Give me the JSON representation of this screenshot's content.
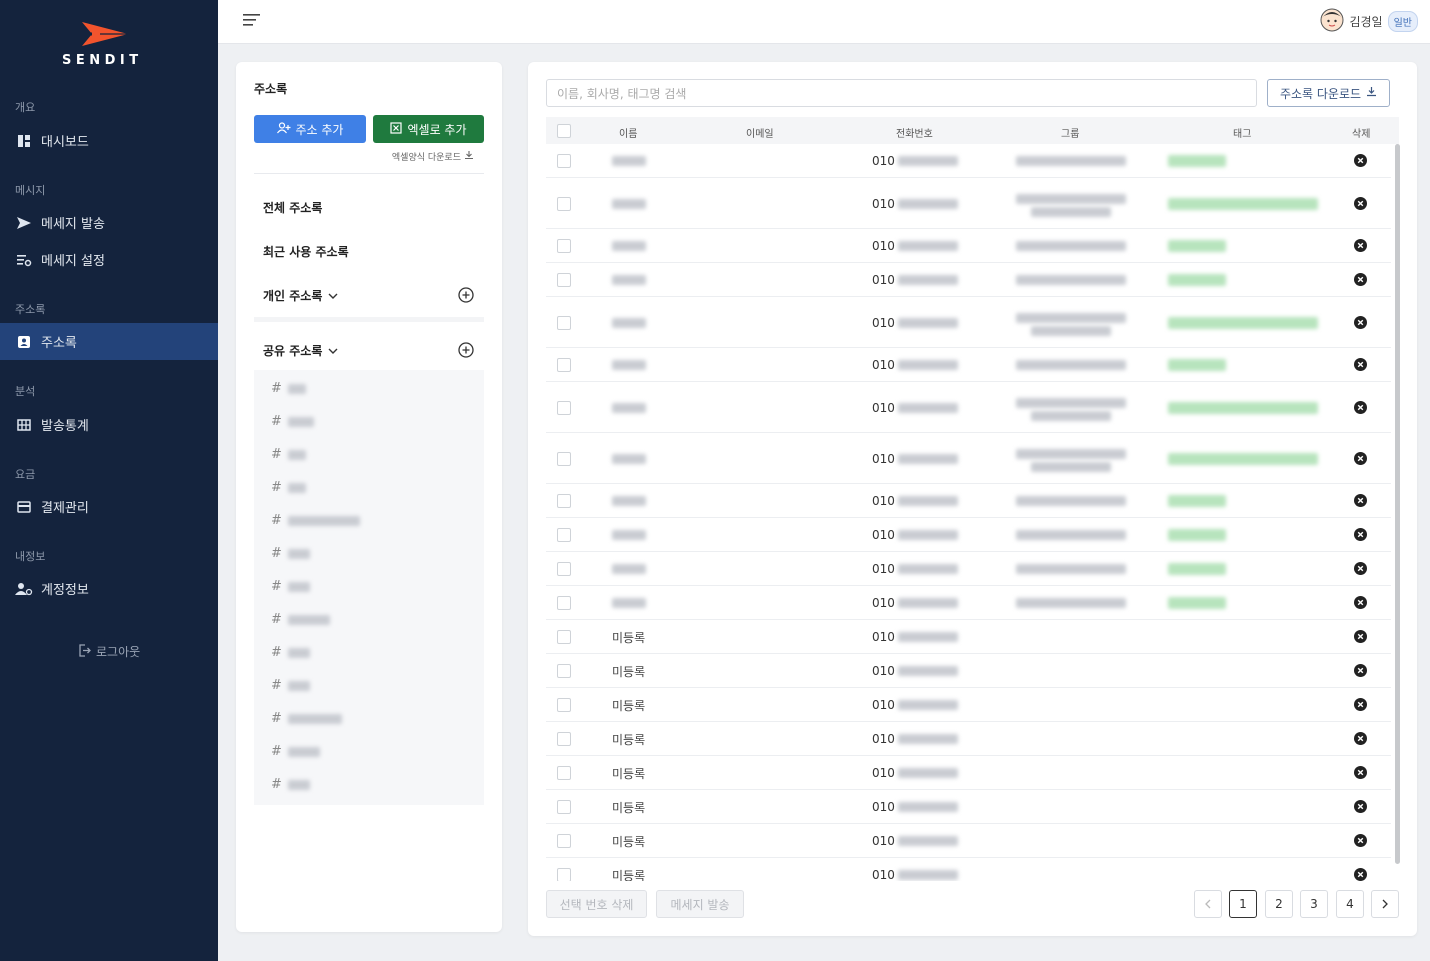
{
  "brand": {
    "name": "SENDIT",
    "accent": "#f2542d"
  },
  "sidebar": {
    "sections": [
      "개요",
      "메시지",
      "주소록",
      "분석",
      "요금",
      "내정보"
    ],
    "items": [
      {
        "label": "대시보드",
        "icon": "dashboard-icon"
      },
      {
        "label": "메세지 발송",
        "icon": "send-icon"
      },
      {
        "label": "메세지 설정",
        "icon": "settings-list-icon"
      },
      {
        "label": "주소록",
        "icon": "contact-book-icon"
      },
      {
        "label": "발송통계",
        "icon": "table-grid-icon"
      },
      {
        "label": "결제관리",
        "icon": "card-icon"
      },
      {
        "label": "계정정보",
        "icon": "user-gear-icon"
      }
    ],
    "logout": "로그아웃"
  },
  "user": {
    "name": "김경일",
    "badge": "일반"
  },
  "address_panel": {
    "title": "주소록",
    "add_button": "주소 추가",
    "excel_button": "엑셀로 추가",
    "excel_download": "엑셀양식 다운로드",
    "all": "전체 주소록",
    "recent": "최근 사용 주소록",
    "personal": "개인 주소록",
    "shared": "공유 주소록",
    "tag_symbol": "#"
  },
  "main": {
    "search_placeholder": "이름, 회사명, 태그명 검색",
    "download_button": "주소록 다운로드",
    "columns": [
      "이름",
      "이메일",
      "전화번호",
      "그룹",
      "태그",
      "삭제"
    ],
    "phone_prefix": "010",
    "unregistered": "미등록",
    "delete_selected": "선택 번호 삭제",
    "send_message": "메세지 발송",
    "pages": [
      "1",
      "2",
      "3",
      "4"
    ],
    "current_page": "1"
  }
}
